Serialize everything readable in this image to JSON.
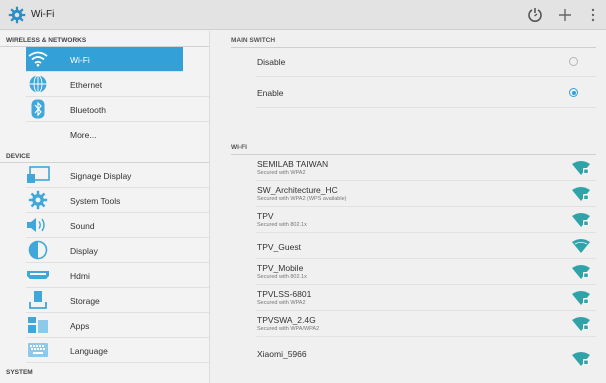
{
  "actionbar": {
    "title": "Wi-Fi",
    "icons": [
      "settings-icon",
      "wps-icon",
      "add-icon",
      "overflow-menu-icon"
    ]
  },
  "sidebar": {
    "sections": [
      {
        "title": "WIRELESS & NETWORKS",
        "items": [
          {
            "label": "Wi-Fi",
            "icon": "wifi-icon",
            "active": true
          },
          {
            "label": "Ethernet",
            "icon": "ethernet-icon"
          },
          {
            "label": "Bluetooth",
            "icon": "bluetooth-icon"
          },
          {
            "label": "More...",
            "icon": ""
          }
        ]
      },
      {
        "title": "DEVICE",
        "items": [
          {
            "label": "Signage Display",
            "icon": "signage-display-icon"
          },
          {
            "label": "System Tools",
            "icon": "system-tools-icon"
          },
          {
            "label": "Sound",
            "icon": "sound-icon"
          },
          {
            "label": "Display",
            "icon": "display-icon"
          },
          {
            "label": "Hdmi",
            "icon": "hdmi-icon"
          },
          {
            "label": "Storage",
            "icon": "storage-icon"
          },
          {
            "label": "Apps",
            "icon": "apps-icon"
          },
          {
            "label": "Language",
            "icon": "language-icon"
          }
        ]
      },
      {
        "title": "SYSTEM",
        "items": []
      }
    ]
  },
  "main_switch": {
    "header": "MAIN SWITCH",
    "options": [
      {
        "label": "Disable",
        "selected": false
      },
      {
        "label": "Enable",
        "selected": true
      }
    ]
  },
  "wifi": {
    "header": "WI-FI",
    "networks": [
      {
        "ssid": "SEMILAB TAIWAN",
        "security": "Secured with WPA2",
        "locked": true
      },
      {
        "ssid": "SW_Architecture_HC",
        "security": "Secured with WPA2 (WPS available)",
        "locked": true
      },
      {
        "ssid": "TPV",
        "security": "Secured with 802.1x",
        "locked": true
      },
      {
        "ssid": "TPV_Guest",
        "security": "",
        "locked": false
      },
      {
        "ssid": "TPV_Mobile",
        "security": "Secured with 802.1x",
        "locked": true
      },
      {
        "ssid": "TPVLSS-6801",
        "security": "Secured with WPA2",
        "locked": true
      },
      {
        "ssid": "TPVSWA_2.4G",
        "security": "Secured with WPA/WPA2",
        "locked": true
      },
      {
        "ssid": "Xiaomi_5966",
        "security": "",
        "locked": true
      }
    ]
  },
  "colors": {
    "accent": "#33a0d8",
    "wifi_signal": "#2fa3a8",
    "actionbar": "#e3e3e3"
  }
}
